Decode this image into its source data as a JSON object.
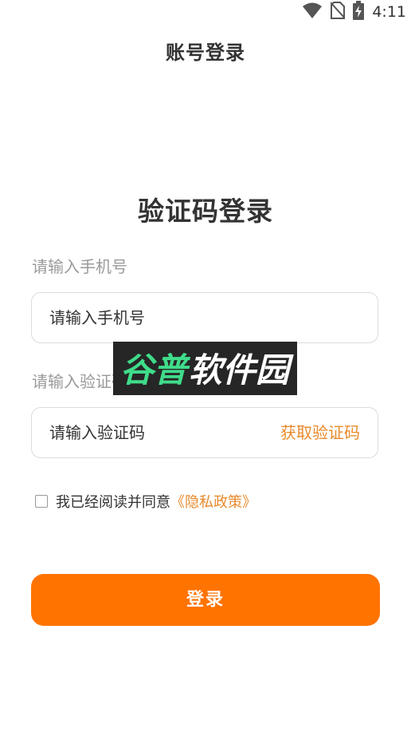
{
  "status_bar": {
    "time": "4:11",
    "icons": [
      "wifi-icon",
      "no-sim-icon",
      "battery-charging-icon"
    ]
  },
  "header": {
    "title": "账号登录"
  },
  "form": {
    "heading": "验证码登录",
    "phone": {
      "label": "请输入手机号",
      "placeholder": "请输入手机号",
      "value": ""
    },
    "code": {
      "label": "请输入验证码",
      "placeholder": "请输入验证码",
      "value": "",
      "get_code_label": "获取验证码"
    },
    "agreement": {
      "checked": false,
      "text": "我已经阅读并同意",
      "link_text": "《隐私政策》"
    },
    "login_button_label": "登录"
  },
  "watermark": {
    "text": "谷普软件园"
  },
  "colors": {
    "accent": "#ff7300",
    "link": "#e88a2c",
    "label": "#9a9a9a",
    "border": "#dcdcdc",
    "watermark_bg": "#262626"
  }
}
